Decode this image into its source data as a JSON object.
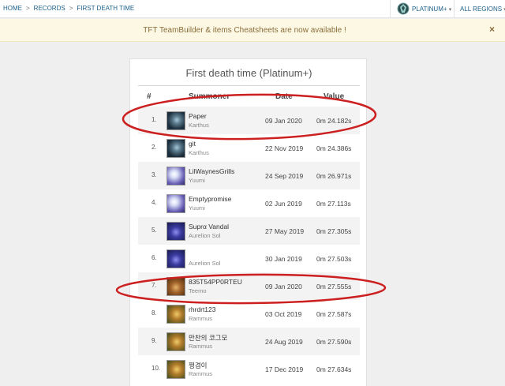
{
  "breadcrumb": {
    "home": "HOME",
    "records": "RECORDS",
    "current": "FIRST DEATH TIME",
    "separator": ">"
  },
  "tier_selector": {
    "label": "PLATINUM+",
    "icon": "platinum-emblem-icon"
  },
  "region_selector": {
    "label": "ALL REGIONS"
  },
  "banner": {
    "text": "TFT TeamBuilder & items Cheatsheets are now available !",
    "close": "×"
  },
  "leaderboard": {
    "title": "First death time (Platinum+)",
    "columns": {
      "rank": "#",
      "summoner": "Summoner",
      "date": "Date",
      "value": "Value"
    },
    "rows": [
      {
        "rank": "1.",
        "name": "Paper",
        "champion": "Karthus",
        "date": "09 Jan 2020",
        "value": "0m 24.182s",
        "avatar": "karthus"
      },
      {
        "rank": "2.",
        "name": "git",
        "champion": "Karthus",
        "date": "22 Nov 2019",
        "value": "0m 24.386s",
        "avatar": "karthus"
      },
      {
        "rank": "3.",
        "name": "LilWaynesGrills",
        "champion": "Yuumi",
        "date": "24 Sep 2019",
        "value": "0m 26.971s",
        "avatar": "yuumi"
      },
      {
        "rank": "4.",
        "name": "Emptypromise",
        "champion": "Yuumi",
        "date": "02 Jun 2019",
        "value": "0m 27.113s",
        "avatar": "yuumi"
      },
      {
        "rank": "5.",
        "name": "Suprα Vandal",
        "champion": "Aurelion Sol",
        "date": "27 May 2019",
        "value": "0m 27.305s",
        "avatar": "aurelion"
      },
      {
        "rank": "6.",
        "name": "",
        "champion": "Aurelion Sol",
        "date": "30 Jan 2019",
        "value": "0m 27.503s",
        "avatar": "aurelion"
      },
      {
        "rank": "7.",
        "name": "835T54PP0RTEU",
        "champion": "Teemo",
        "date": "09 Jan 2020",
        "value": "0m 27.555s",
        "avatar": "teemo"
      },
      {
        "rank": "8.",
        "name": "rhrdrt123",
        "champion": "Rammus",
        "date": "03 Oct 2019",
        "value": "0m 27.587s",
        "avatar": "rammus"
      },
      {
        "rank": "9.",
        "name": "만찬의 코그모",
        "champion": "Rammus",
        "date": "24 Aug 2019",
        "value": "0m 27.590s",
        "avatar": "rammus"
      },
      {
        "rank": "10.",
        "name": "쩡겸이",
        "champion": "Rammus",
        "date": "17 Dec 2019",
        "value": "0m 27.634s",
        "avatar": "rammus"
      }
    ]
  },
  "colors": {
    "link": "#1b5f89",
    "banner_bg": "#fcf8e3",
    "banner_text": "#8a6d3b",
    "annotation": "#cc1f1f"
  }
}
